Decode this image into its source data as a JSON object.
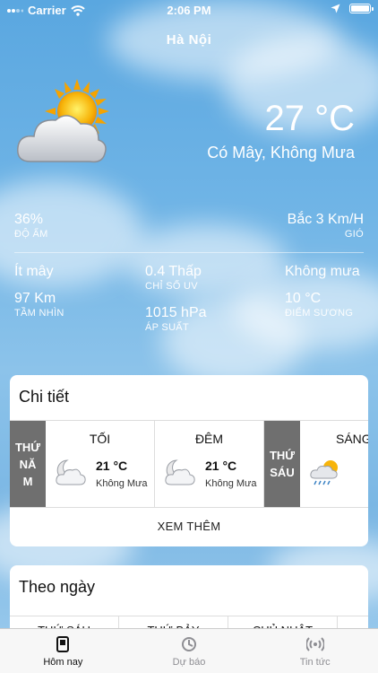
{
  "status_bar": {
    "carrier": "Carrier",
    "time": "2:06 PM"
  },
  "location": {
    "city": "Hà Nội"
  },
  "current": {
    "temperature": "27 °C",
    "condition": "Có Mây, Không Mưa",
    "icon": "sun-cloud-icon"
  },
  "stats": {
    "humidity": {
      "value": "36%",
      "label": "ĐỘ ẨM"
    },
    "wind": {
      "value": "Bắc 3 Km/H",
      "label": "GIÓ"
    },
    "cloud": {
      "value": "Ít mây"
    },
    "uv": {
      "value": "0.4 Thấp",
      "label": "CHỈ SỐ UV"
    },
    "precip": {
      "value": "Không mưa"
    },
    "visibility": {
      "value": "97 Km",
      "label": "TẦM NHÌN"
    },
    "pressure": {
      "value": "1015 hPa",
      "label": "ÁP SUẤT"
    },
    "dewpoint": {
      "value": "10 °C",
      "label": "ĐIỂM SƯƠNG"
    }
  },
  "detail": {
    "title": "Chi tiết",
    "day1": {
      "label_lines": [
        "THỨ",
        "NĂ",
        "M"
      ]
    },
    "slot1": {
      "title": "TỐI",
      "temp": "21 °C",
      "desc": "Không Mưa",
      "icon": "moon-cloud-icon"
    },
    "slot2": {
      "title": "ĐÊM",
      "temp": "21 °C",
      "desc": "Không Mưa",
      "icon": "moon-cloud-icon"
    },
    "day2": {
      "label_lines": [
        "THỨ",
        "SÁU"
      ]
    },
    "slot3": {
      "title": "SÁNG",
      "icon": "sun-rain-cloud-icon"
    },
    "see_more": "XEM THÊM"
  },
  "daily": {
    "title": "Theo ngày",
    "days": [
      "THỨ SÁU",
      "THỨ BẢY",
      "CHỦ NHẬT"
    ]
  },
  "tabs": [
    {
      "label": "Hôm nay",
      "icon": "today-icon",
      "active": true
    },
    {
      "label": "Dự báo",
      "icon": "forecast-icon",
      "active": false
    },
    {
      "label": "Tin tức",
      "icon": "news-icon",
      "active": false
    }
  ]
}
